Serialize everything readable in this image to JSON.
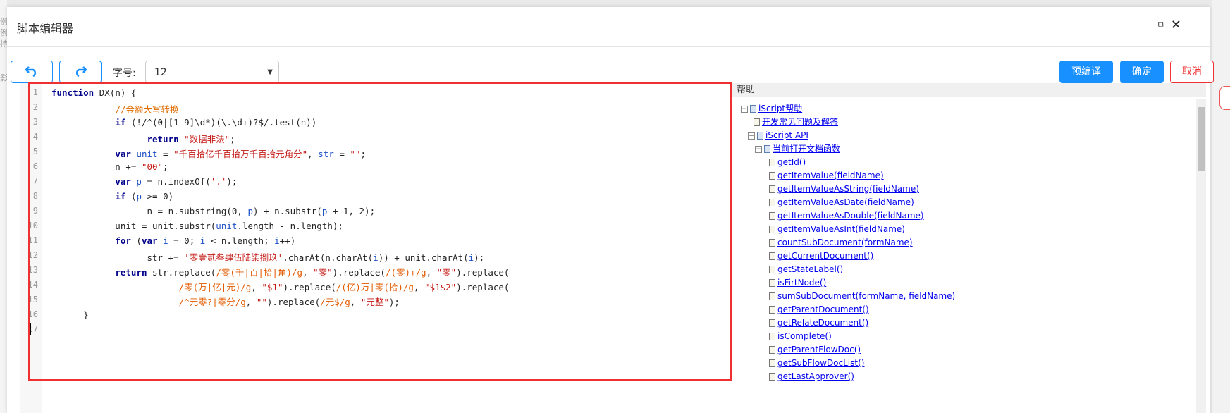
{
  "background": {
    "left_labels": [
      "例",
      "例",
      "持",
      "影"
    ]
  },
  "dialog": {
    "title": "脚本编辑器",
    "maximize_icon": "external-link-icon",
    "close_icon": "close-icon"
  },
  "toolbar": {
    "undo_icon": "undo-icon",
    "redo_icon": "redo-icon",
    "font_size_label": "字号:",
    "font_size_value": "12",
    "precompile_label": "预编译",
    "confirm_label": "确定",
    "cancel_label": "取消"
  },
  "editor": {
    "line_numbers": [
      "1",
      "2",
      "3",
      "4",
      "5",
      "6",
      "7",
      "8",
      "9",
      "10",
      "11",
      "12",
      "13",
      "14",
      "15",
      "16",
      "17"
    ],
    "lines": [
      "function DX(n) {",
      "            //金额大写转换",
      "            if (!/^(0|[1-9]\\d*)(\\.\\d+)?$/.test(n))",
      "                  return \"数据非法\";",
      "            var unit = \"千百拾亿千百拾万千百拾元角分\", str = \"\";",
      "            n += \"00\";",
      "            var p = n.indexOf('.');",
      "            if (p >= 0)",
      "                  n = n.substring(0, p) + n.substr(p + 1, 2);",
      "            unit = unit.substr(unit.length - n.length);",
      "            for (var i = 0; i < n.length; i++)",
      "                  str += '零壹贰叁肆伍陆柒捌玖'.charAt(n.charAt(i)) + unit.charAt(i);",
      "            return str.replace(/零(千|百|拾|角)/g, \"零\").replace(/(零)+/g, \"零\").replace(",
      "                        /零(万|亿|元)/g, \"$1\").replace(/(亿)万|零(拾)/g, \"$1$2\").replace(",
      "                        /^元零?|零分/g, \"\").replace(/元$/g, \"元整\");",
      "      }",
      ""
    ]
  },
  "help": {
    "header": "帮助",
    "tree": [
      {
        "text": "iScript帮助",
        "link": true,
        "expander": "⊟"
      },
      {
        "text": "开发常见问题及解答",
        "link": true
      },
      {
        "text": "iScript API",
        "link": true,
        "expander": "⊟"
      },
      {
        "text": "当前打开文档函数",
        "link": true,
        "expander": "⊟"
      },
      {
        "text": "getId()",
        "link": true
      },
      {
        "text": "getItemValue(fieldName)",
        "link": true
      },
      {
        "text": "getItemValueAsString(fieldName)",
        "link": true
      },
      {
        "text": "getItemValueAsDate(fieldName)",
        "link": true
      },
      {
        "text": "getItemValueAsDouble(fieldName)",
        "link": true
      },
      {
        "text": "getItemValueAsInt(fieldName)",
        "link": true
      },
      {
        "text": "countSubDocument(formName)",
        "link": true
      },
      {
        "text": "getCurrentDocument()",
        "link": true
      },
      {
        "text": "getStateLabel()",
        "link": true
      },
      {
        "text": "isFirtNode()",
        "link": true
      },
      {
        "text": "sumSubDocument(formName, fieldName)",
        "link": true
      },
      {
        "text": "getParentDocument()",
        "link": true
      },
      {
        "text": "getRelateDocument()",
        "link": true
      },
      {
        "text": "isComplete()",
        "link": true
      },
      {
        "text": "getParentFlowDoc()",
        "link": true
      },
      {
        "text": "getSubFlowDocList()",
        "link": true
      },
      {
        "text": "getLastApprover()",
        "link": true
      }
    ]
  }
}
